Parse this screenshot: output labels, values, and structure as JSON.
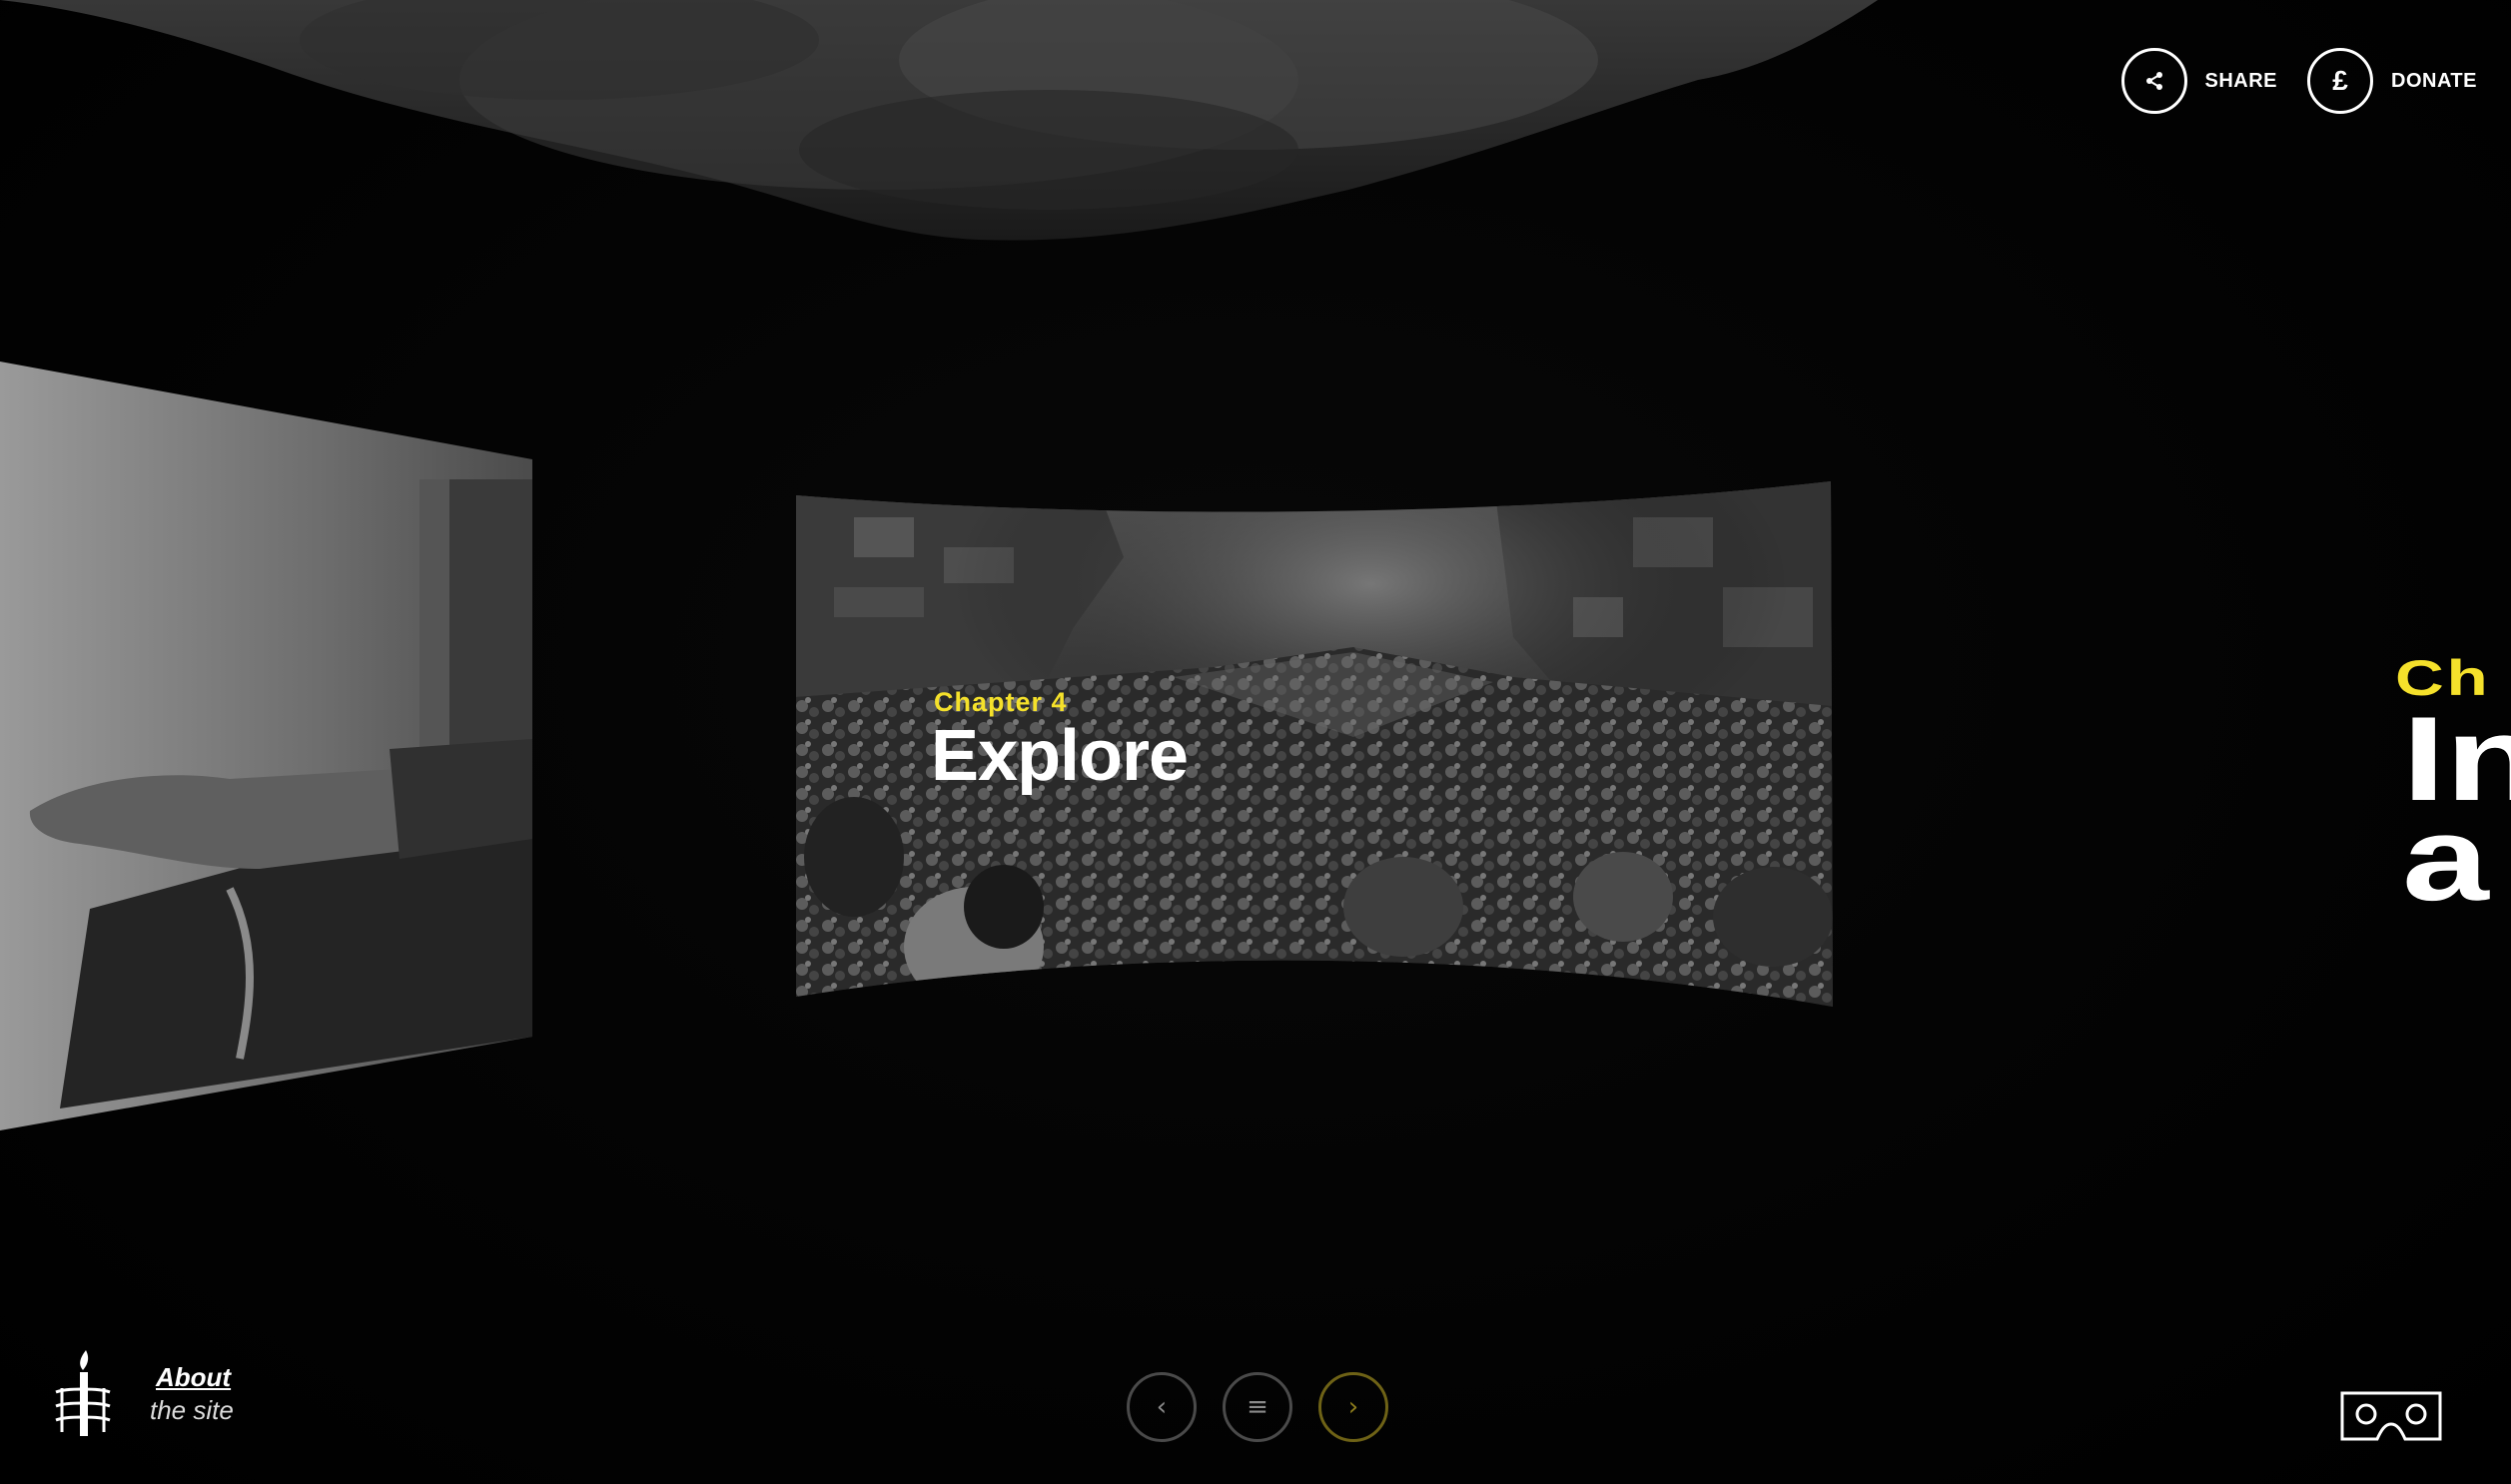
{
  "header": {
    "share_label": "SHARE",
    "donate_label": "DONATE",
    "donate_symbol": "£"
  },
  "center_panel": {
    "chapter_label": "Chapter 4",
    "title": "Explore"
  },
  "right_panel": {
    "chapter_label_partial": "Ch",
    "title_line1_partial": "In",
    "title_line2_partial": "a"
  },
  "footer": {
    "about_title": "About",
    "about_subtitle": "the site",
    "prev_symbol": "‹",
    "menu_symbol": "≡",
    "next_symbol": "›"
  },
  "icons": {
    "share": "share-icon",
    "donate": "pound-icon",
    "logo": "amnesty-candle-icon",
    "vr": "vr-headset-icon"
  },
  "colors": {
    "accent_yellow": "#f5e12b",
    "background": "#020202",
    "text": "#ffffff"
  }
}
